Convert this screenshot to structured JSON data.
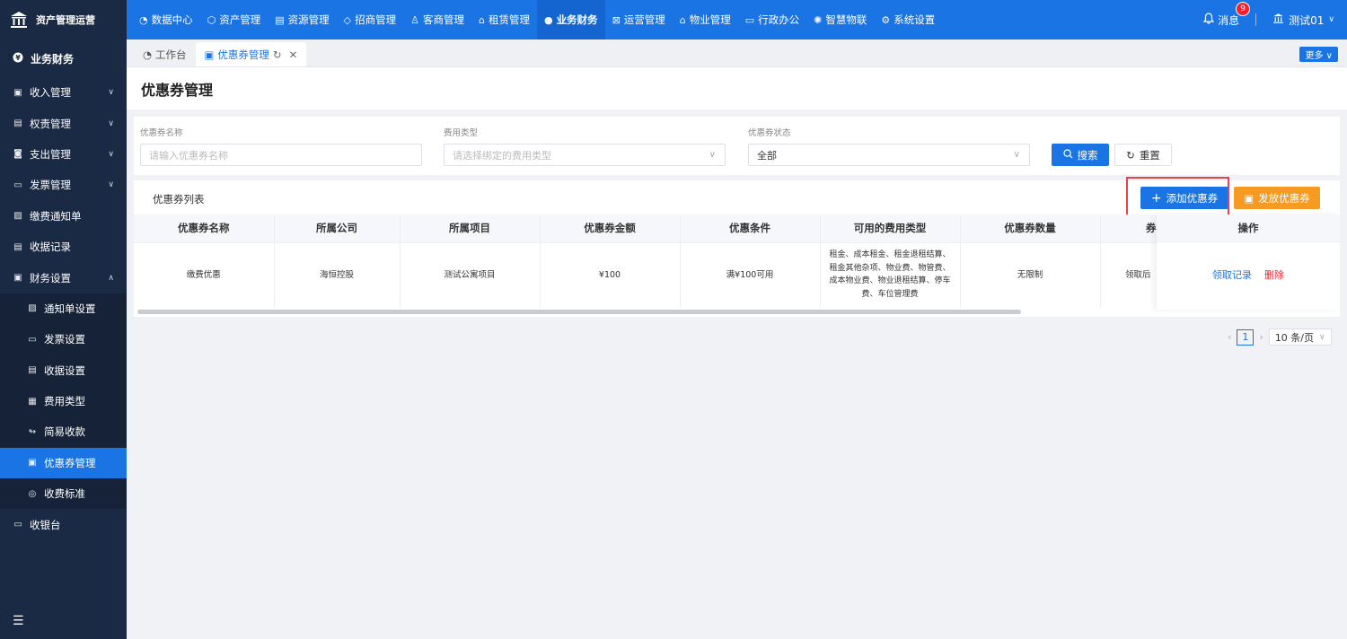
{
  "app": {
    "title": "资产管理运营",
    "accent_color": "#1b74e4",
    "sidebar_color": "#1a2a44"
  },
  "topnav": {
    "items": [
      {
        "label": "数据中心",
        "icon": "pie-chart-icon"
      },
      {
        "label": "资产管理",
        "icon": "cube-icon"
      },
      {
        "label": "资源管理",
        "icon": "building-icon"
      },
      {
        "label": "招商管理",
        "icon": "tag-icon"
      },
      {
        "label": "客商管理",
        "icon": "users-icon"
      },
      {
        "label": "租赁管理",
        "icon": "house-icon"
      },
      {
        "label": "业务财务",
        "icon": "yen-icon",
        "active": true
      },
      {
        "label": "运营管理",
        "icon": "ops-icon"
      },
      {
        "label": "物业管理",
        "icon": "home-icon"
      },
      {
        "label": "行政办公",
        "icon": "monitor-icon"
      },
      {
        "label": "智慧物联",
        "icon": "iot-icon"
      },
      {
        "label": "系统设置",
        "icon": "gear-icon"
      }
    ],
    "messages_label": "消息",
    "messages_count": "9",
    "user_label": "测试01"
  },
  "sidebar": {
    "header": "业务财务",
    "items": [
      {
        "label": "收入管理",
        "expandable": true
      },
      {
        "label": "权责管理",
        "expandable": true
      },
      {
        "label": "支出管理",
        "expandable": true
      },
      {
        "label": "发票管理",
        "expandable": true
      },
      {
        "label": "缴费通知单"
      },
      {
        "label": "收据记录"
      },
      {
        "label": "财务设置",
        "expanded": true
      },
      {
        "label": "通知单设置",
        "sub": true
      },
      {
        "label": "发票设置",
        "sub": true
      },
      {
        "label": "收据设置",
        "sub": true
      },
      {
        "label": "费用类型",
        "sub": true
      },
      {
        "label": "简易收款",
        "sub": true
      },
      {
        "label": "优惠券管理",
        "sub": true,
        "active": true
      },
      {
        "label": "收费标准",
        "sub": true
      },
      {
        "label": "收银台"
      }
    ]
  },
  "tabs": {
    "items": [
      {
        "label": "工作台",
        "active": false
      },
      {
        "label": "优惠券管理",
        "active": true
      }
    ],
    "more_label": "更多"
  },
  "page": {
    "title": "优惠券管理"
  },
  "search": {
    "name_label": "优惠券名称",
    "name_placeholder": "请输入优惠券名称",
    "fee_type_label": "费用类型",
    "fee_type_placeholder": "请选择绑定的费用类型",
    "status_label": "优惠券状态",
    "status_value": "全部",
    "search_button": "搜索",
    "reset_button": "重置"
  },
  "list": {
    "title": "优惠券列表",
    "add_button": "添加优惠券",
    "issue_button": "发放优惠券",
    "columns": [
      "优惠券名称",
      "所属公司",
      "所属项目",
      "优惠券金额",
      "优惠条件",
      "可用的费用类型",
      "优惠券数量",
      "券"
    ],
    "ops_header": "操作",
    "rows": [
      {
        "cells": [
          "缴费优惠",
          "海恒控股",
          "测试公寓项目",
          "¥100",
          "满¥100可用",
          "租金、成本租金、租金退租结算、租金其他杂项、物业费、物管费、成本物业费、物业退租结算、停车费、车位管理费",
          "无限制",
          "领取后"
        ],
        "ops": [
          "领取记录",
          "删除"
        ]
      }
    ]
  },
  "pagination": {
    "current_page": "1",
    "page_size": "10 条/页"
  }
}
